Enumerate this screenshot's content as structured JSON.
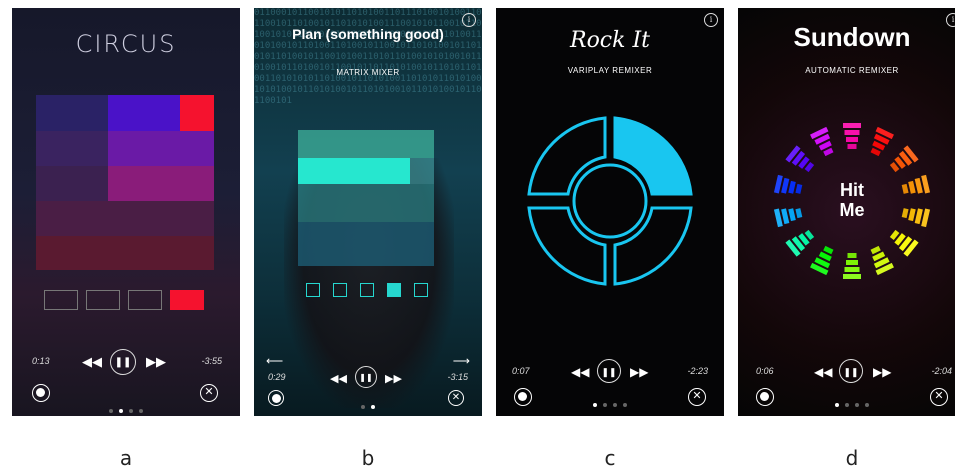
{
  "screens": [
    {
      "title": "CIRCUS",
      "time_elapsed": "0:13",
      "time_remaining": "-3:55",
      "caption": "a"
    },
    {
      "title": "Plan (something good)",
      "subtitle": "MATRIX MIXER",
      "time_elapsed": "0:29",
      "time_remaining": "-3:15",
      "caption": "b",
      "binary_text": "0110001011001010110101001101110100101001101100101101001011010101001110010101100101101001010110100101011001011010010110110100110101001011010011010010110010110101001011010101101001011001010011010110100101010010110100101101001011001011011010100101101011010011010101011010010110101001101010110101001010100101101010010110101001011010100101101100101"
    },
    {
      "title": "Rock It",
      "subtitle": "VARIPLAY REMIXER",
      "time_elapsed": "0:07",
      "time_remaining": "-2:23",
      "caption": "c"
    },
    {
      "title": "Sundown",
      "subtitle": "AUTOMATIC REMIXER",
      "center_line1": "Hit",
      "center_line2": "Me",
      "time_elapsed": "0:06",
      "time_remaining": "-2:04",
      "caption": "d"
    }
  ],
  "icons": {
    "rewind": "◀◀",
    "forward": "▶▶",
    "pause": "❚❚",
    "close": "✕",
    "info": "i",
    "arrow_left": "⟵",
    "arrow_right": "⟶"
  },
  "colors": {
    "circus_accent": "#f5122e",
    "matrix_accent": "#26d7cf",
    "variplay_accent": "#19c6f0"
  }
}
